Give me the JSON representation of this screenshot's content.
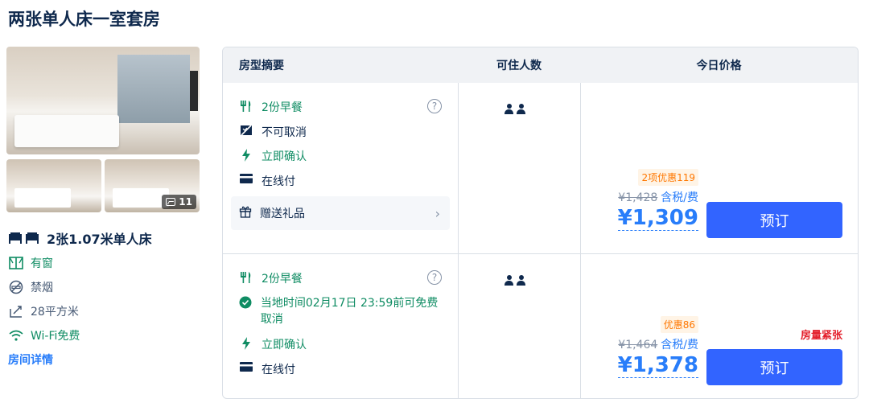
{
  "room": {
    "title": "两张单人床一室套房",
    "photo_count": "11",
    "bed_type": "2张1.07米单人床",
    "features": [
      {
        "icon": "window-icon",
        "label": "有窗"
      },
      {
        "icon": "no-smoking-icon",
        "label": "禁烟"
      },
      {
        "icon": "area-icon",
        "label": "28平方米"
      },
      {
        "icon": "wifi-icon",
        "label": "Wi-Fi免费"
      }
    ],
    "details_link": "房间详情"
  },
  "table": {
    "headers": [
      "房型摘要",
      "可住人数",
      "今日价格"
    ]
  },
  "offers": [
    {
      "breakfast": "2份早餐",
      "cancel": "不可取消",
      "confirm": "立即确认",
      "payment": "在线付",
      "gift": "赠送礼品",
      "guests": 2,
      "promo": "2项优惠119",
      "original_price": "¥1,428",
      "tax_label": "含税/费",
      "final_price": "¥1,309",
      "book_label": "预订"
    },
    {
      "breakfast": "2份早餐",
      "cancel": "当地时间02月17日 23:59前可免费取消",
      "confirm": "立即确认",
      "payment": "在线付",
      "guests": 2,
      "promo": "优惠86",
      "original_price": "¥1,464",
      "tax_label": "含税/费",
      "final_price": "¥1,378",
      "book_label": "预订",
      "scarcity": "房量紧张"
    }
  ],
  "colors": {
    "accent": "#287dfa",
    "button": "#3264ff",
    "green": "#0f8c63",
    "promo": "#ff7700",
    "alert": "#e3202c"
  }
}
